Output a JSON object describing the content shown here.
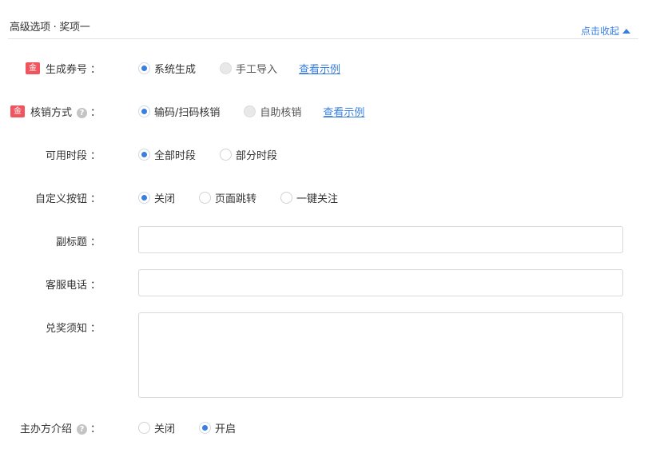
{
  "header": {
    "title": "高级选项 · 奖项一",
    "collapse_label": "点击收起"
  },
  "rows": {
    "generate_code": {
      "badge": "金",
      "label": "生成券号",
      "colon": "：",
      "options": [
        "系统生成",
        "手工导入"
      ],
      "selected": "系统生成",
      "link": "查看示例"
    },
    "redeem_method": {
      "badge": "金",
      "label": "核销方式",
      "help": "?",
      "colon": "：",
      "options": [
        "输码/扫码核销",
        "自助核销"
      ],
      "selected": "输码/扫码核销",
      "link": "查看示例"
    },
    "available_period": {
      "label": "可用时段",
      "colon": "：",
      "options": [
        "全部时段",
        "部分时段"
      ],
      "selected": "全部时段"
    },
    "custom_button": {
      "label": "自定义按钮",
      "colon": "：",
      "options": [
        "关闭",
        "页面跳转",
        "一键关注"
      ],
      "selected": "关闭"
    },
    "subtitle": {
      "label": "副标题",
      "colon": "：",
      "value": ""
    },
    "service_phone": {
      "label": "客服电话",
      "colon": "：",
      "value": ""
    },
    "redeem_notes": {
      "label": "兑奖须知",
      "colon": "：",
      "value": ""
    },
    "organizer_intro": {
      "label": "主办方介绍",
      "help": "?",
      "colon": "：",
      "options": [
        "关闭",
        "开启"
      ],
      "selected": "开启"
    }
  },
  "colors": {
    "accent": "#3a7fe0",
    "badge": "#f1545d",
    "border": "#d9d9d9"
  }
}
